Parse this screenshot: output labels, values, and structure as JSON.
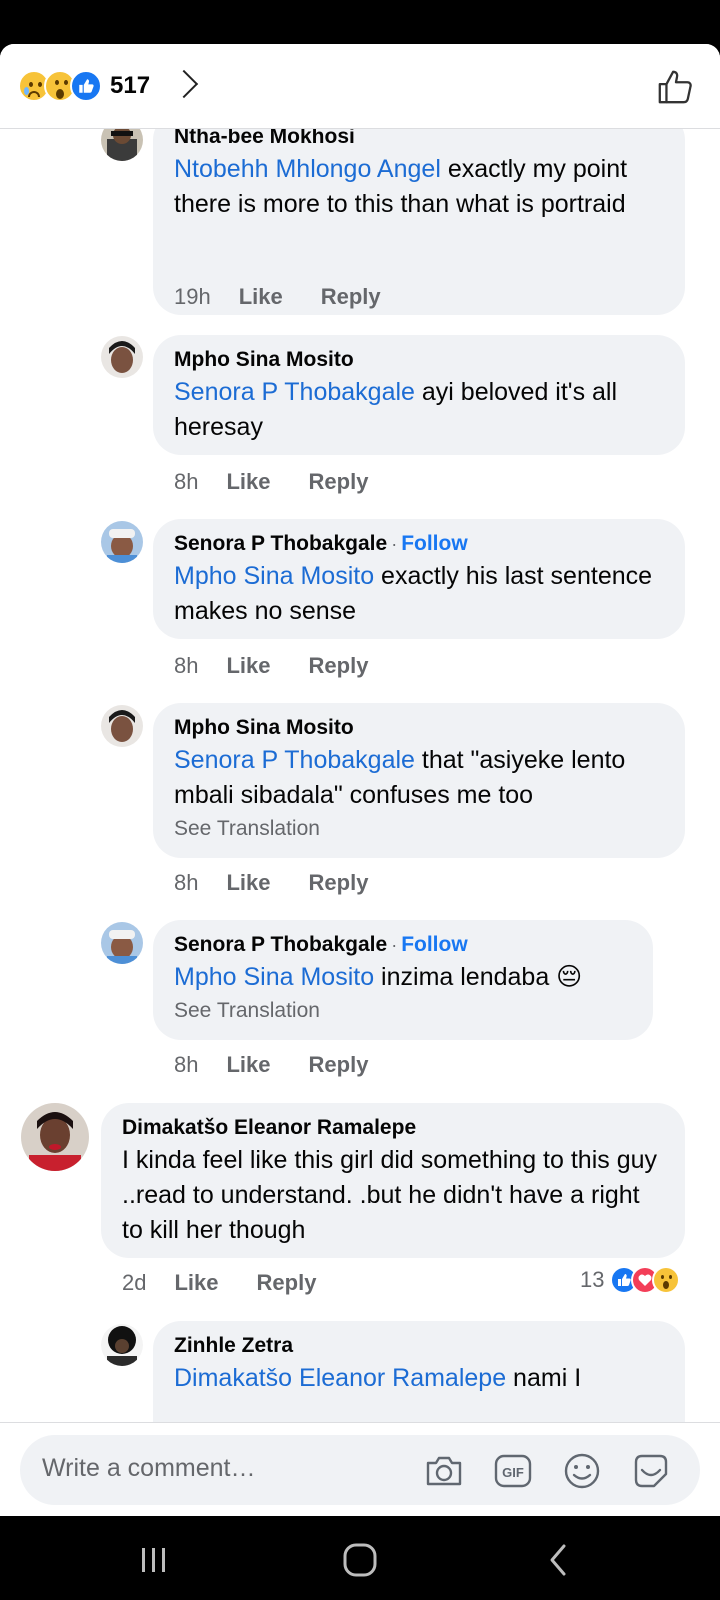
{
  "reaction_bar": {
    "count": "517",
    "icons": [
      "sad-icon",
      "wow-icon",
      "like-icon"
    ]
  },
  "comments": [
    {
      "author": "Ntha-bee Mokhosi",
      "mention": "Ntobehh Mhlongo Angel",
      "text": " exactly my point there is more to this than what is portraid",
      "time": "19h",
      "like": "Like",
      "reply": "Reply"
    },
    {
      "author": "Mpho Sina Mosito",
      "mention": "Senora P Thobakgale",
      "text": " ayi beloved it's all heresay",
      "time": "8h",
      "like": "Like",
      "reply": "Reply"
    },
    {
      "author": "Senora P Thobakgale",
      "follow_sep": "·",
      "follow": "Follow",
      "mention": "Mpho Sina Mosito",
      "text": " exactly his last sentence makes no sense",
      "time": "8h",
      "like": "Like",
      "reply": "Reply"
    },
    {
      "author": "Mpho Sina Mosito",
      "mention": "Senora P Thobakgale",
      "text": " that \"asiyeke lento mbali sibadala\" confuses me too",
      "see_translation": "See Translation",
      "time": "8h",
      "like": "Like",
      "reply": "Reply"
    },
    {
      "author": "Senora P Thobakgale",
      "follow_sep": "·",
      "follow": "Follow",
      "mention": "Mpho Sina Mosito",
      "text": " inzima lendaba 😔",
      "see_translation": "See Translation",
      "time": "8h",
      "like": "Like",
      "reply": "Reply"
    },
    {
      "author": "Dimakatšo Eleanor Ramalepe",
      "text": "I kinda feel like this girl did something to this guy ..read to understand. .but he didn't have a right to kill her though",
      "time": "2d",
      "like": "Like",
      "reply": "Reply",
      "reaction_count": "13"
    },
    {
      "author": "Zinhle Zetra",
      "mention": "Dimakatšo Eleanor Ramalepe",
      "text": " nami I"
    }
  ],
  "composer": {
    "placeholder": "Write a comment…",
    "icons": [
      "camera-icon",
      "gif-icon",
      "emoji-icon",
      "sticker-icon"
    ]
  },
  "nav": {
    "icons": [
      "recent-apps-icon",
      "home-icon",
      "back-icon"
    ]
  },
  "colors": {
    "accent": "#1877f2",
    "bubble": "#f0f2f5",
    "meta": "#65676b"
  }
}
